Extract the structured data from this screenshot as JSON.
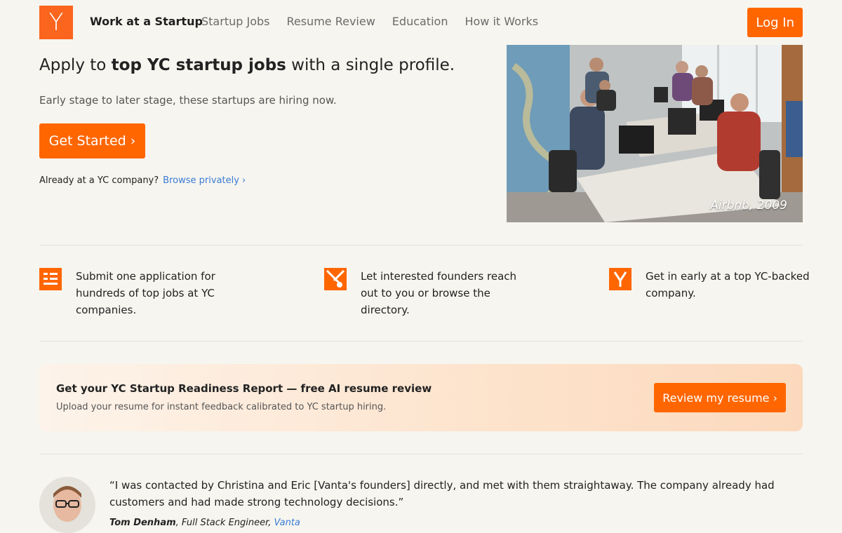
{
  "header": {
    "logo_letter": "Y",
    "brand": "Work at a Startup",
    "nav": [
      "Startup Jobs",
      "Resume Review",
      "Education",
      "How it Works"
    ],
    "login": "Log In"
  },
  "hero": {
    "title_pre": "Apply to ",
    "title_bold": "top YC startup jobs",
    "title_post": " with a single profile.",
    "subtitle": "Early stage to later stage, these startups are hiring now.",
    "cta": "Get Started ›",
    "already_text": "Already at a YC company?",
    "browse_link": "Browse privately ›",
    "photo_caption": "Airbnb, 2009"
  },
  "features": [
    {
      "text": "Submit one application for hundreds of top jobs at YC companies.",
      "icon": "application-form-icon"
    },
    {
      "text": "Let interested founders reach out to you or browse the directory.",
      "icon": "connect-icon"
    },
    {
      "text": "Get in early at a top YC-backed company.",
      "icon": "yc-logo-icon"
    }
  ],
  "banner": {
    "title": "Get your YC Startup Readiness Report — free AI resume review",
    "subtitle": "Upload your resume for instant feedback calibrated to YC startup hiring.",
    "button": "Review my resume ›"
  },
  "testimonial": {
    "quote": "“I was contacted by Christina and Eric [Vanta's founders] directly, and met with them straightaway. The company already had customers and had made strong technology decisions.”",
    "author": "Tom Denham",
    "role": ", Full Stack Engineer, ",
    "company": "Vanta"
  },
  "colors": {
    "accent": "#ff6600",
    "link": "#3a7bd5",
    "background": "#f6f5ef"
  }
}
